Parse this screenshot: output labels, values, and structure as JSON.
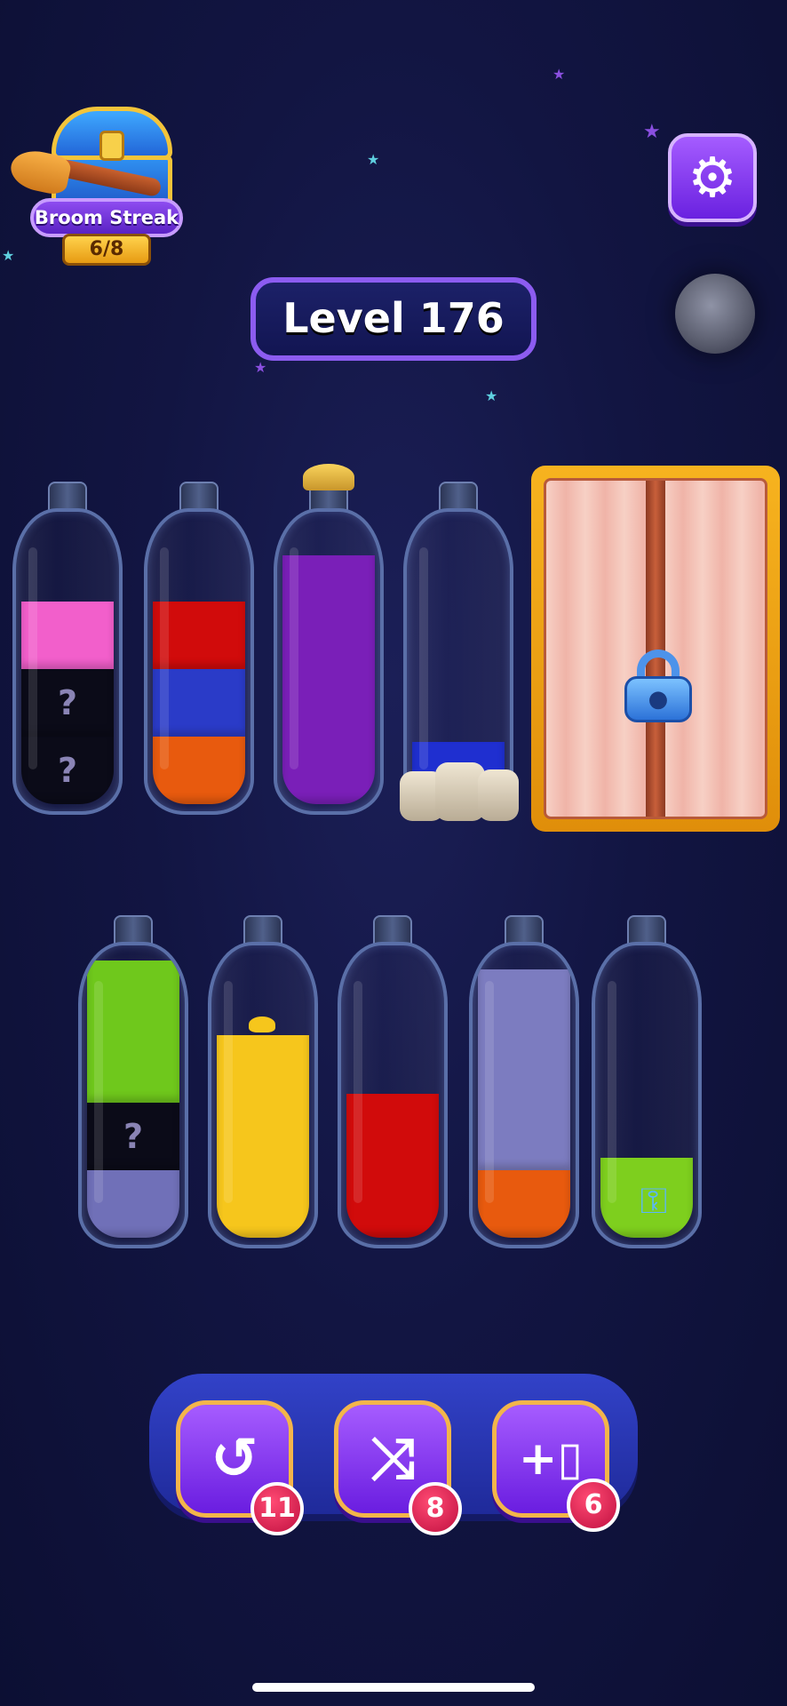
{
  "header": {
    "streak_label": "Broom Streak",
    "streak_count": "6/8",
    "level_label": "Level 176",
    "settings_icon": "gear-icon"
  },
  "bottles": [
    {
      "id": 1,
      "layers": [
        {
          "color": "#0b0b18",
          "label": "?"
        },
        {
          "color": "#0b0b18",
          "label": "?"
        },
        {
          "color": "#f25fcb",
          "label": ""
        }
      ]
    },
    {
      "id": 2,
      "layers": [
        {
          "color": "#e85a0e",
          "label": ""
        },
        {
          "color": "#2a3bc8",
          "label": ""
        },
        {
          "color": "#d10b0b",
          "label": ""
        }
      ]
    },
    {
      "id": 3,
      "layers": [
        {
          "color": "#7a1fb8",
          "label": ""
        }
      ],
      "corked": true
    },
    {
      "id": 4,
      "layers": [
        {
          "color": "#1f2fd0",
          "label": ""
        }
      ],
      "rock_icon": "rocks-icon"
    },
    {
      "id": 5,
      "layers": [
        {
          "color": "#7070b8",
          "label": ""
        },
        {
          "color": "#0b0b18",
          "label": "?"
        },
        {
          "color": "#6fc81c",
          "label": ""
        }
      ]
    },
    {
      "id": 6,
      "layers": [
        {
          "color": "#f6c61c",
          "label": ""
        }
      ]
    },
    {
      "id": 7,
      "layers": [
        {
          "color": "#d10b0b",
          "label": ""
        }
      ]
    },
    {
      "id": 8,
      "layers": [
        {
          "color": "#e85a0e",
          "label": ""
        },
        {
          "color": "#7c7cc0",
          "label": ""
        }
      ]
    },
    {
      "id": 9,
      "layers": [
        {
          "color": "#7ecf1e",
          "label": ""
        }
      ],
      "key_icon": "key-icon"
    }
  ],
  "locked_slot": {
    "icon": "padlock-icon"
  },
  "actions": {
    "undo": {
      "icon": "undo-icon",
      "count": "11"
    },
    "shuffle": {
      "icon": "shuffle-icon",
      "count": "8"
    },
    "add_bottle": {
      "icon": "add-bottle-icon",
      "count": "6"
    }
  }
}
